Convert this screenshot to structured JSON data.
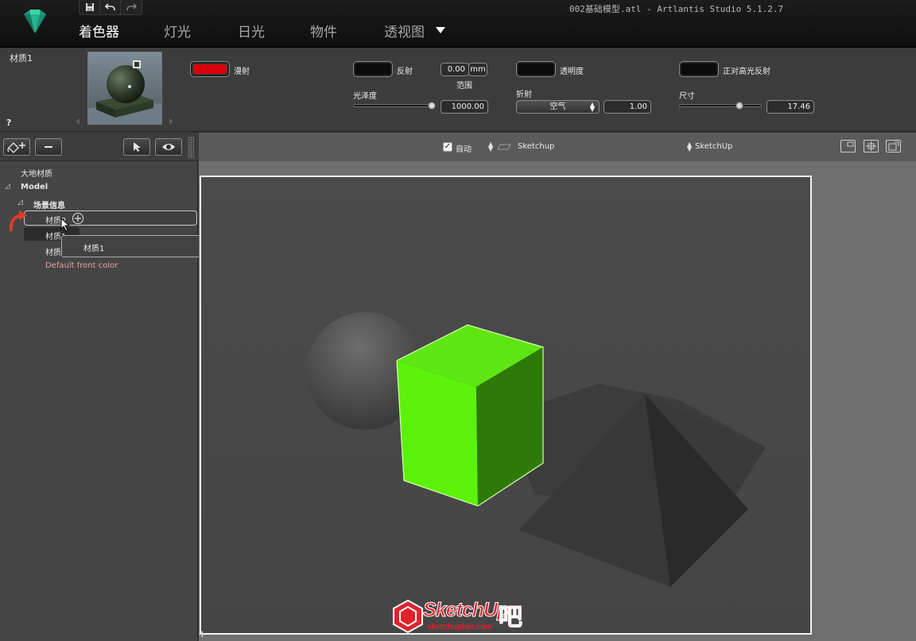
{
  "window": {
    "title": "002基础模型.atl - Artlantis Studio 5.1.2.7"
  },
  "tabs": [
    {
      "label": "着色器",
      "active": true
    },
    {
      "label": "灯光",
      "active": false
    },
    {
      "label": "日光",
      "active": false
    },
    {
      "label": "物件",
      "active": false
    },
    {
      "label": "透视图",
      "active": false
    }
  ],
  "material": {
    "name": "材质1",
    "help": "?",
    "diffuse": {
      "label": "漫射",
      "color": "#d8000c"
    },
    "reflection": {
      "label": "反射",
      "color": "#0b0b0b"
    },
    "range": {
      "value": "0.00",
      "unit": "mm",
      "label": "范围"
    },
    "gloss": {
      "label": "光泽度",
      "value": "1000.00",
      "level": 1.0
    },
    "transparency": {
      "label": "透明度",
      "color": "#0b0b0b"
    },
    "refraction": {
      "label": "折射",
      "medium": "空气",
      "value": "1.00"
    },
    "specular": {
      "label": "正对高光反射",
      "color": "#0b0b0b"
    },
    "size": {
      "label": "尺寸",
      "value": "17.46",
      "level": 0.72
    }
  },
  "tree": {
    "items": [
      {
        "label": "大地材质"
      },
      {
        "label": "Model",
        "bold": true
      },
      {
        "label": "场景信息",
        "bold": true
      },
      {
        "label": "材质2"
      },
      {
        "label": "材质1"
      },
      {
        "label": "材质3"
      },
      {
        "label": "Default front color",
        "color": "#e8a0a0"
      }
    ],
    "drag_label": "材质1",
    "add_glyph": "+"
  },
  "viewport": {
    "auto_label": "自动",
    "auto_checked": true,
    "camera_label": "Sketchup",
    "source_label": "SketchUp"
  },
  "watermark": {
    "brand": "SketchUp",
    "suffix": "吧",
    "site": "sketchupbar.com"
  },
  "colors": {
    "accent_green": "#5af20a",
    "background": "#3a3a3a"
  }
}
